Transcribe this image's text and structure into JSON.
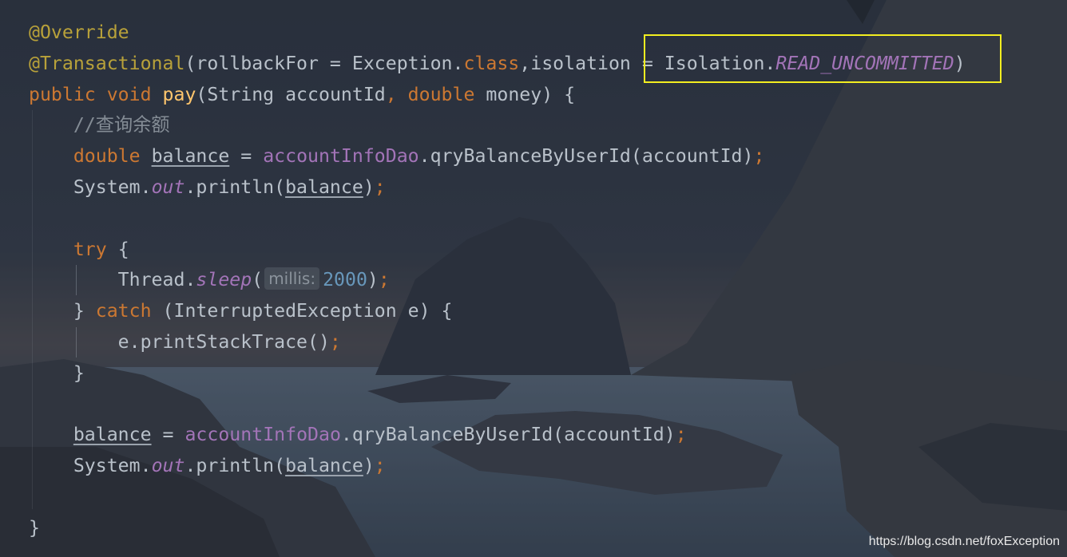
{
  "editor": {
    "lines": [
      [
        {
          "t": "@Override",
          "c": "ann"
        }
      ],
      [
        {
          "t": "@Transactional",
          "c": "ann"
        },
        {
          "t": "(rollbackFor = Exception."
        },
        {
          "t": "class",
          "c": "kw"
        },
        {
          "t": ","
        },
        {
          "t": "isolation = Isolation."
        },
        {
          "t": "READ_UNCOMMITTED",
          "c": "field"
        },
        {
          "t": ")"
        }
      ],
      [
        {
          "t": "public void ",
          "c": "kw"
        },
        {
          "t": "pay",
          "c": "fn"
        },
        {
          "t": "(String accountId"
        },
        {
          "t": ", ",
          "c": "kw"
        },
        {
          "t": "double ",
          "c": "kw"
        },
        {
          "t": "money) {"
        }
      ],
      [
        {
          "t": "    "
        },
        {
          "t": "//查询余额",
          "c": "cmt"
        }
      ],
      [
        {
          "t": "    "
        },
        {
          "t": "double ",
          "c": "kw"
        },
        {
          "t": "balance",
          "c": "ul"
        },
        {
          "t": " = "
        },
        {
          "t": "accountInfoDao",
          "c": "inst"
        },
        {
          "t": ".qryBalanceByUserId(accountId)"
        },
        {
          "t": ";",
          "c": "semi"
        }
      ],
      [
        {
          "t": "    System."
        },
        {
          "t": "out",
          "c": "field"
        },
        {
          "t": ".println("
        },
        {
          "t": "balance",
          "c": "ul"
        },
        {
          "t": ")"
        },
        {
          "t": ";",
          "c": "semi"
        }
      ],
      [],
      [
        {
          "t": "    "
        },
        {
          "t": "try ",
          "c": "kw"
        },
        {
          "t": "{"
        }
      ],
      [
        {
          "t": "        Thread."
        },
        {
          "t": "sleep",
          "c": "field"
        },
        {
          "t": "("
        },
        {
          "t": "millis:",
          "c": "hint"
        },
        {
          "t": "2000",
          "c": "num"
        },
        {
          "t": ")"
        },
        {
          "t": ";",
          "c": "semi"
        }
      ],
      [
        {
          "t": "    } "
        },
        {
          "t": "catch ",
          "c": "kw"
        },
        {
          "t": "(InterruptedException e) {"
        }
      ],
      [
        {
          "t": "        e.printStackTrace()"
        },
        {
          "t": ";",
          "c": "semi"
        }
      ],
      [
        {
          "t": "    }"
        }
      ],
      [],
      [
        {
          "t": "    "
        },
        {
          "t": "balance",
          "c": "ul"
        },
        {
          "t": " = "
        },
        {
          "t": "accountInfoDao",
          "c": "inst"
        },
        {
          "t": ".qryBalanceByUserId(accountId)"
        },
        {
          "t": ";",
          "c": "semi"
        }
      ],
      [
        {
          "t": "    System."
        },
        {
          "t": "out",
          "c": "field"
        },
        {
          "t": ".println("
        },
        {
          "t": "balance",
          "c": "ul"
        },
        {
          "t": ")"
        },
        {
          "t": ";",
          "c": "semi"
        }
      ],
      [],
      [
        {
          "t": "}"
        }
      ]
    ]
  },
  "highlight": {
    "color": "#f3ee20",
    "label": "isolation annotation highlight"
  },
  "watermark": {
    "text": "https://blog.csdn.net/foxException"
  },
  "colors": {
    "annotation": "#b8a13a",
    "keyword": "#cc7832",
    "method": "#ffc66d",
    "static_field": "#a374b8",
    "number": "#6897bb",
    "comment": "#848c95",
    "default_text": "#b9c1ca"
  }
}
